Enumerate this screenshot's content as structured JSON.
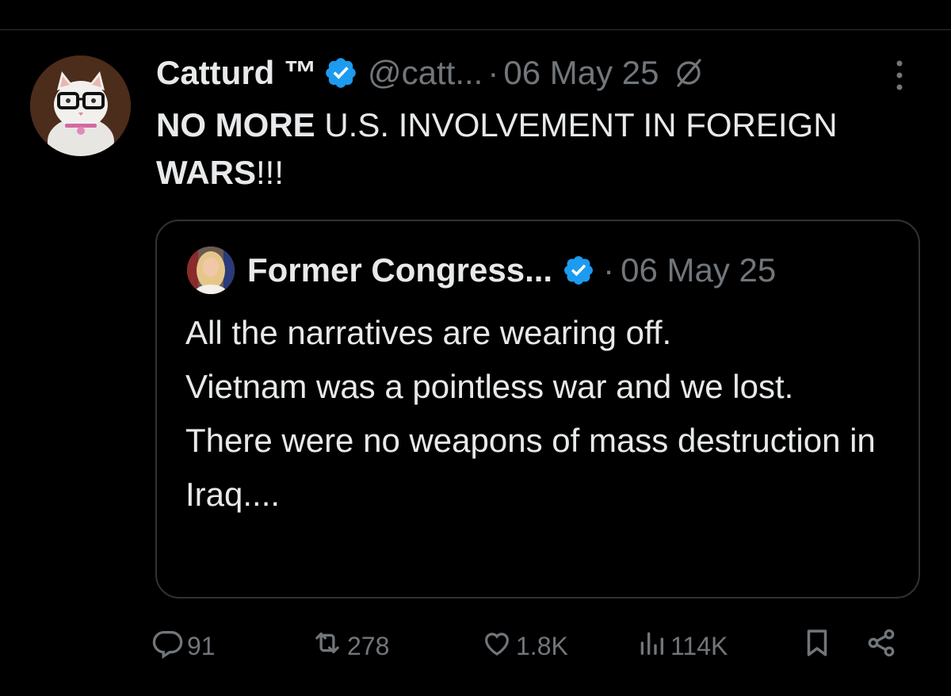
{
  "tweet": {
    "author": {
      "display_name": "Catturd ™",
      "handle": "@catt...",
      "verified": true
    },
    "separator": "·",
    "date": "06 May 25",
    "text_parts": [
      {
        "text": "NO MORE",
        "bold": true
      },
      {
        "text": " U.S. INVOLVEMENT IN FOREIGN ",
        "bold": false
      },
      {
        "text": "WARS",
        "bold": true
      },
      {
        "text": "!!!",
        "bold": false
      }
    ]
  },
  "quote": {
    "author": {
      "display_name": "Former Congress...",
      "verified": true
    },
    "separator": "·",
    "date": "06 May 25",
    "text": "All the narratives are wearing off.\nVietnam was a pointless war and we lost.\nThere were no weapons of mass destruction in Iraq...."
  },
  "actions": {
    "replies": "91",
    "reposts": "278",
    "likes": "1.8K",
    "views": "114K"
  },
  "colors": {
    "background": "#000000",
    "text_primary": "#e7e9ea",
    "text_secondary": "#71767b",
    "border": "#2f3336",
    "verified_blue": "#1d9bf0"
  },
  "icons": {
    "verified": "verified-badge-icon",
    "grok": "grok-icon",
    "more": "more-vertical-icon",
    "reply": "reply-icon",
    "repost": "repost-icon",
    "like": "heart-icon",
    "views": "views-icon",
    "bookmark": "bookmark-icon",
    "share": "share-icon"
  }
}
